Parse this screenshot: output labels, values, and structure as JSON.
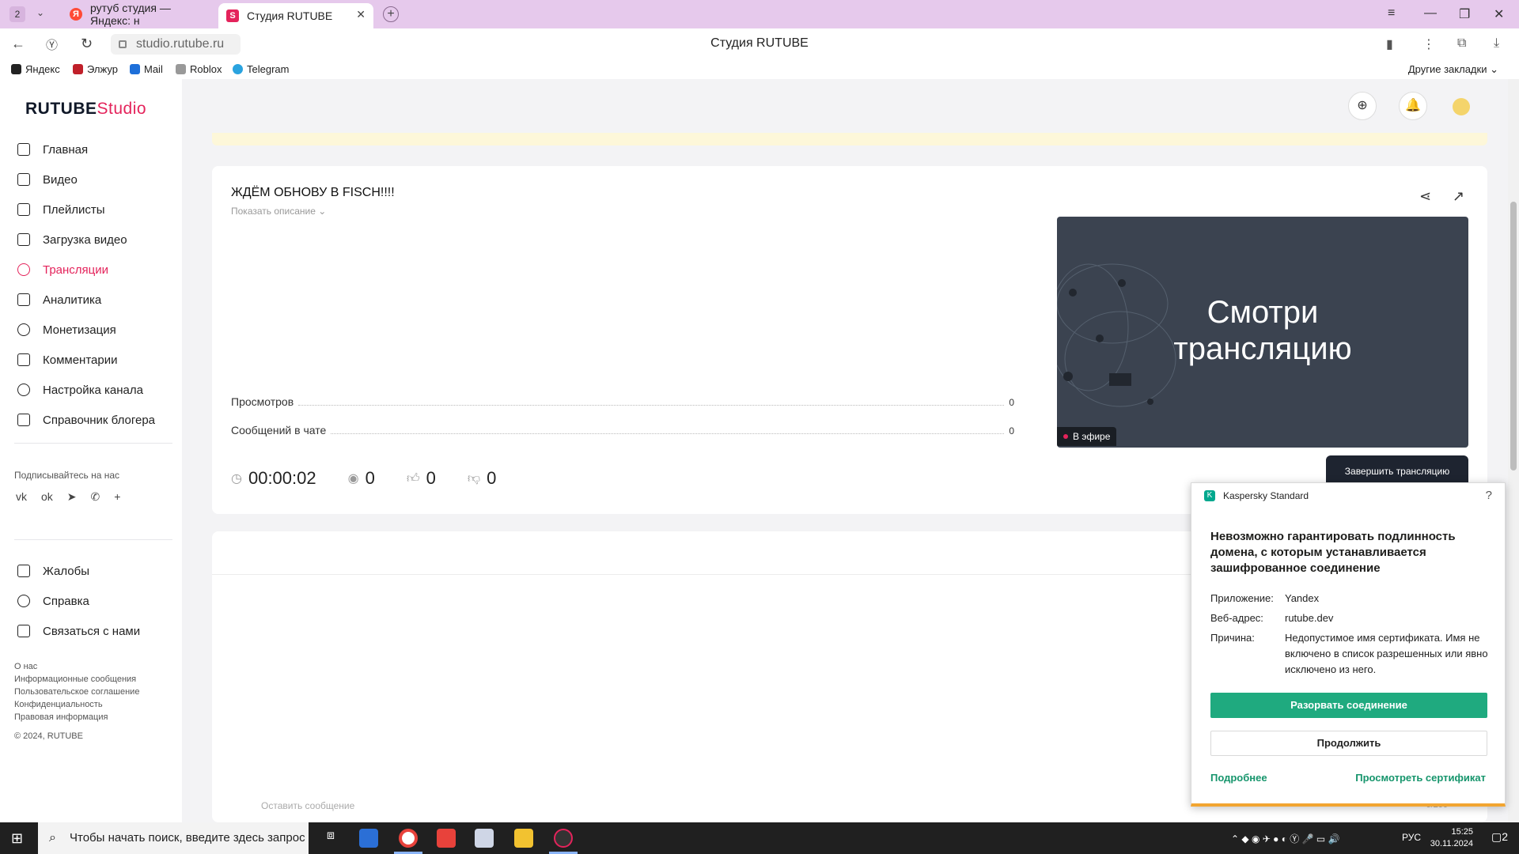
{
  "browser": {
    "tab_count": "2",
    "tabs": [
      {
        "label": "рутуб студия — Яндекс: н"
      },
      {
        "label": "Студия RUTUBE"
      }
    ],
    "new_tab": "+",
    "url": "studio.rutube.ru",
    "page_title": "Студия RUTUBE",
    "bookmarks": [
      "Яндекс",
      "Элжур",
      "Mail",
      "Roblox",
      "Telegram"
    ],
    "other_bookmarks": "Другие закладки"
  },
  "sidebar": {
    "logo_main": "RUTUBE",
    "logo_studio": "Studio",
    "items": [
      {
        "label": "Главная"
      },
      {
        "label": "Видео"
      },
      {
        "label": "Плейлисты"
      },
      {
        "label": "Загрузка видео"
      },
      {
        "label": "Трансляции"
      },
      {
        "label": "Аналитика"
      },
      {
        "label": "Монетизация"
      },
      {
        "label": "Комментарии"
      },
      {
        "label": "Настройка канала"
      },
      {
        "label": "Справочник блогера"
      }
    ],
    "active_item": "Трансляции",
    "subscribe_label": "Подписывайтесь на нас",
    "secondary_items": [
      {
        "label": "Жалобы"
      },
      {
        "label": "Справка"
      },
      {
        "label": "Связаться с нами"
      }
    ],
    "footer_links": [
      "О нас",
      "Информационные сообщения",
      "Пользовательское соглашение",
      "Конфиденциальность",
      "Правовая информация"
    ],
    "copyright": "© 2024, RUTUBE"
  },
  "stream": {
    "title": "ЖДЁМ ОБНОВУ В FISCH!!!!",
    "show_description": "Показать описание",
    "stats": [
      {
        "label": "Просмотров",
        "value": "0"
      },
      {
        "label": "Сообщений в чате",
        "value": "0"
      }
    ],
    "preview_text_line1": "Смотри",
    "preview_text_line2": "трансляцию",
    "live_badge": "В эфире",
    "duration": "00:00:02",
    "viewers": "0",
    "likes": "0",
    "dislikes": "0",
    "end_button": "Завершить трансляцию"
  },
  "chat": {
    "placeholder": "Оставить сообщение",
    "counter": "0/200"
  },
  "kaspersky": {
    "product": "Kaspersky Standard",
    "title": "Невозможно гарантировать подлинность домена, с которым устанавливается зашифрованное соединение",
    "app_label": "Приложение:",
    "app_value": "Yandex",
    "url_label": "Веб-адрес:",
    "url_value": "rutube.dev",
    "reason_label": "Причина:",
    "reason_value": "Недопустимое имя сертификата. Имя не включено в список разрешенных или явно исключено из него.",
    "break_button": "Разорвать соединение",
    "continue_button": "Продолжить",
    "more_link": "Подробнее",
    "cert_link": "Просмотреть сертификат"
  },
  "taskbar": {
    "search_placeholder": "Чтобы начать поиск, введите здесь запрос",
    "lang": "РУС",
    "time": "15:25",
    "date": "30.11.2024",
    "notifications": "2"
  },
  "colors": {
    "accent": "#e4235b",
    "kaspersky_green": "#1faa7f",
    "tab_bar": "#e6c9ec"
  }
}
